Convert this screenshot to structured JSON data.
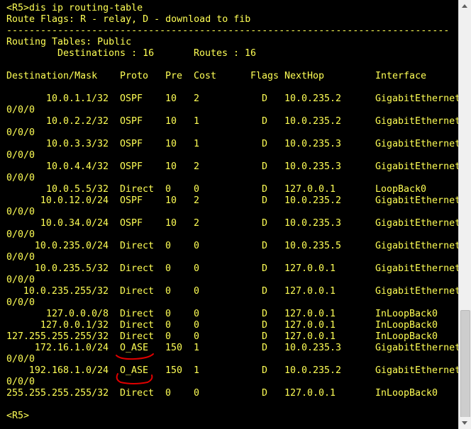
{
  "terminal": {
    "command_line": "<R5>dis ip routing-table",
    "flags_line": "Route Flags: R - relay, D - download to fib",
    "separator": "------------------------------------------------------------------------------",
    "tables_line": "Routing Tables: Public",
    "dest_label": "Destinations : 16",
    "routes_label": "Routes : 16",
    "headers": {
      "dest": "Destination/Mask",
      "proto": "Proto",
      "pre": "Pre",
      "cost": "Cost",
      "flags": "Flags",
      "nexthop": "NextHop",
      "interface": "Interface"
    },
    "routes": [
      {
        "dest": "10.0.1.1/32",
        "proto": "OSPF",
        "pre": "10",
        "cost": "2",
        "flags": "D",
        "nexthop": "10.0.235.2",
        "iface": "GigabitEthernet",
        "wrap": "0/0/0"
      },
      {
        "dest": "10.0.2.2/32",
        "proto": "OSPF",
        "pre": "10",
        "cost": "1",
        "flags": "D",
        "nexthop": "10.0.235.2",
        "iface": "GigabitEthernet",
        "wrap": "0/0/0"
      },
      {
        "dest": "10.0.3.3/32",
        "proto": "OSPF",
        "pre": "10",
        "cost": "1",
        "flags": "D",
        "nexthop": "10.0.235.3",
        "iface": "GigabitEthernet",
        "wrap": "0/0/0"
      },
      {
        "dest": "10.0.4.4/32",
        "proto": "OSPF",
        "pre": "10",
        "cost": "2",
        "flags": "D",
        "nexthop": "10.0.235.3",
        "iface": "GigabitEthernet",
        "wrap": "0/0/0"
      },
      {
        "dest": "10.0.5.5/32",
        "proto": "Direct",
        "pre": "0",
        "cost": "0",
        "flags": "D",
        "nexthop": "127.0.0.1",
        "iface": "LoopBack0",
        "wrap": ""
      },
      {
        "dest": "10.0.12.0/24",
        "proto": "OSPF",
        "pre": "10",
        "cost": "2",
        "flags": "D",
        "nexthop": "10.0.235.2",
        "iface": "GigabitEthernet",
        "wrap": "0/0/0"
      },
      {
        "dest": "10.0.34.0/24",
        "proto": "OSPF",
        "pre": "10",
        "cost": "2",
        "flags": "D",
        "nexthop": "10.0.235.3",
        "iface": "GigabitEthernet",
        "wrap": "0/0/0"
      },
      {
        "dest": "10.0.235.0/24",
        "proto": "Direct",
        "pre": "0",
        "cost": "0",
        "flags": "D",
        "nexthop": "10.0.235.5",
        "iface": "GigabitEthernet",
        "wrap": "0/0/0"
      },
      {
        "dest": "10.0.235.5/32",
        "proto": "Direct",
        "pre": "0",
        "cost": "0",
        "flags": "D",
        "nexthop": "127.0.0.1",
        "iface": "GigabitEthernet",
        "wrap": "0/0/0"
      },
      {
        "dest": "10.0.235.255/32",
        "proto": "Direct",
        "pre": "0",
        "cost": "0",
        "flags": "D",
        "nexthop": "127.0.0.1",
        "iface": "GigabitEthernet",
        "wrap": "0/0/0"
      },
      {
        "dest": "127.0.0.0/8",
        "proto": "Direct",
        "pre": "0",
        "cost": "0",
        "flags": "D",
        "nexthop": "127.0.0.1",
        "iface": "InLoopBack0",
        "wrap": ""
      },
      {
        "dest": "127.0.0.1/32",
        "proto": "Direct",
        "pre": "0",
        "cost": "0",
        "flags": "D",
        "nexthop": "127.0.0.1",
        "iface": "InLoopBack0",
        "wrap": ""
      },
      {
        "dest": "127.255.255.255/32",
        "proto": "Direct",
        "pre": "0",
        "cost": "0",
        "flags": "D",
        "nexthop": "127.0.0.1",
        "iface": "InLoopBack0",
        "wrap": ""
      },
      {
        "dest": "172.16.1.0/24",
        "proto": "O_ASE",
        "pre": "150",
        "cost": "1",
        "flags": "D",
        "nexthop": "10.0.235.3",
        "iface": "GigabitEthernet",
        "wrap": "0/0/0"
      },
      {
        "dest": "192.168.1.0/24",
        "proto": "O_ASE",
        "pre": "150",
        "cost": "1",
        "flags": "D",
        "nexthop": "10.0.235.2",
        "iface": "GigabitEthernet",
        "wrap": "0/0/0"
      },
      {
        "dest": "255.255.255.255/32",
        "proto": "Direct",
        "pre": "0",
        "cost": "0",
        "flags": "D",
        "nexthop": "127.0.0.1",
        "iface": "InLoopBack0",
        "wrap": ""
      }
    ],
    "prompt": "<R5>"
  },
  "colors": {
    "background": "#000000",
    "text": "#ffff55",
    "annotation": "#e00000"
  }
}
